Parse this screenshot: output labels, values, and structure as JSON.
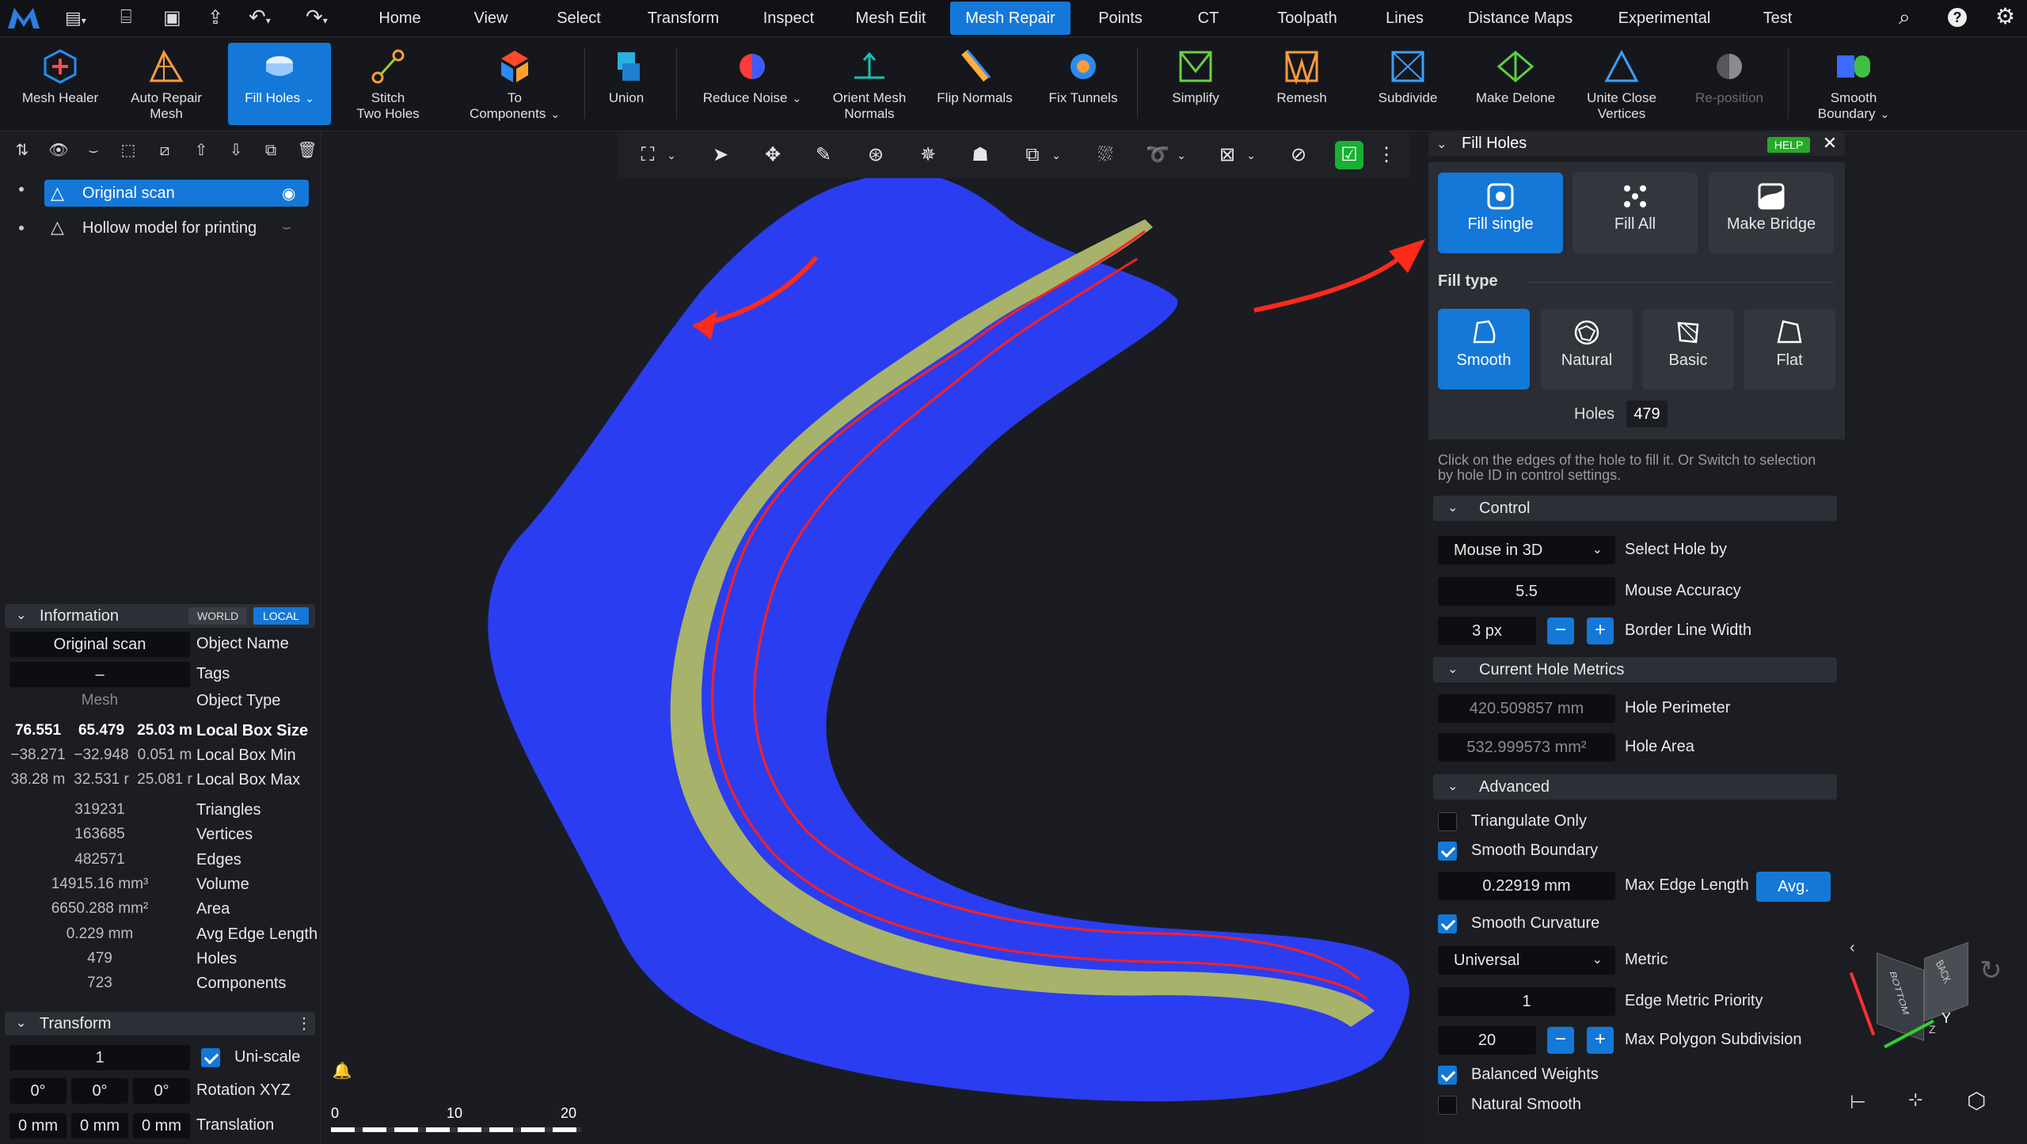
{
  "menubar": {
    "items": [
      "Home",
      "View",
      "Select",
      "Transform",
      "Inspect",
      "Mesh Edit",
      "Mesh Repair",
      "Points",
      "CT",
      "Toolpath",
      "Lines",
      "Distance Maps",
      "Experimental",
      "Test"
    ],
    "active": "Mesh Repair"
  },
  "ribbon": {
    "mesh_healer": "Mesh Healer",
    "auto_repair": [
      "Auto Repair",
      "Mesh"
    ],
    "fill_holes": "Fill Holes",
    "stitch": [
      "Stitch",
      "Two Holes"
    ],
    "to_components": [
      "To",
      "Components"
    ],
    "union": "Union",
    "reduce_noise": "Reduce Noise",
    "orient": [
      "Orient Mesh",
      "Normals"
    ],
    "flip_normals": "Flip Normals",
    "fix_tunnels": "Fix Tunnels",
    "simplify": "Simplify",
    "remesh": "Remesh",
    "subdivide": "Subdivide",
    "make_delone": "Make Delone",
    "unite_close": [
      "Unite Close",
      "Vertices"
    ],
    "reposition": "Re-position",
    "smooth_boundary": [
      "Smooth",
      "Boundary"
    ]
  },
  "tree": {
    "item1": "Original scan",
    "item2": "Hollow model for printing"
  },
  "information": {
    "title": "Information",
    "world": "WORLD",
    "local": "LOCAL",
    "object_name_value": "Original scan",
    "object_name_label": "Object Name",
    "tags_value": "–",
    "tags_label": "Tags",
    "object_type_value": "Mesh",
    "object_type_label": "Object Type",
    "box_size": [
      "76.551",
      "65.479",
      "25.03 m"
    ],
    "box_size_label": "Local Box Size",
    "box_min": [
      "−38.271",
      "−32.948",
      "0.051 m"
    ],
    "box_min_label": "Local Box Min",
    "box_max": [
      "38.28 m",
      "32.531 r",
      "25.081 r"
    ],
    "box_max_label": "Local Box Max",
    "triangles": "319231",
    "triangles_label": "Triangles",
    "vertices": "163685",
    "vertices_label": "Vertices",
    "edges": "482571",
    "edges_label": "Edges",
    "volume": "14915.16 mm³",
    "volume_label": "Volume",
    "area": "6650.288 mm²",
    "area_label": "Area",
    "avg_edge": "0.229 mm",
    "avg_edge_label": "Avg Edge Length",
    "holes": "479",
    "holes_label": "Holes",
    "components": "723",
    "components_label": "Components"
  },
  "transform": {
    "title": "Transform",
    "scale": "1",
    "uniscale": "Uni-scale",
    "rot": [
      "0°",
      "0°",
      "0°"
    ],
    "rot_label": "Rotation XYZ",
    "trans": [
      "0 mm",
      "0 mm",
      "0 mm"
    ],
    "trans_label": "Translation"
  },
  "scale_bar": {
    "t0": "0",
    "t1": "10",
    "t2": "20"
  },
  "fill_holes_panel": {
    "title": "Fill Holes",
    "help": "HELP",
    "fill_single": "Fill single",
    "fill_all": "Fill All",
    "make_bridge": "Make Bridge",
    "fill_type_label": "Fill type",
    "smooth": "Smooth",
    "natural": "Natural",
    "basic": "Basic",
    "flat": "Flat",
    "holes_label": "Holes",
    "holes_value": "479",
    "hint": "Click on the edges of the hole to fill it. Or Switch to selection by hole ID in control settings.",
    "control": "Control",
    "select_hole_value": "Mouse in 3D",
    "select_hole_label": "Select Hole by",
    "mouse_accuracy_value": "5.5",
    "mouse_accuracy_label": "Mouse Accuracy",
    "border_width_value": "3 px",
    "border_width_label": "Border Line Width",
    "metrics": "Current Hole Metrics",
    "perimeter_value": "420.509857 mm",
    "perimeter_label": "Hole Perimeter",
    "area_value": "532.999573 mm²",
    "area_label": "Hole Area",
    "advanced": "Advanced",
    "triangulate_only": "Triangulate Only",
    "smooth_boundary": "Smooth Boundary",
    "max_edge_value": "0.22919 mm",
    "max_edge_label": "Max Edge Length",
    "avg_button": "Avg.",
    "smooth_curvature": "Smooth Curvature",
    "metric_value": "Universal",
    "metric_label": "Metric",
    "edge_priority_value": "1",
    "edge_priority_label": "Edge Metric Priority",
    "max_poly_value": "20",
    "max_poly_label": "Max Polygon Subdivision",
    "balanced_weights": "Balanced Weights",
    "natural_smooth": "Natural Smooth"
  },
  "viewcube": {
    "bottom": "BOTTOM",
    "back": "BACK",
    "y": "Y",
    "z": "Z"
  },
  "colors": {
    "accent": "#1478d8",
    "mesh_blue": "#2b3df0",
    "mesh_green": "#a7b36a",
    "boundary_red": "#ff2020"
  }
}
